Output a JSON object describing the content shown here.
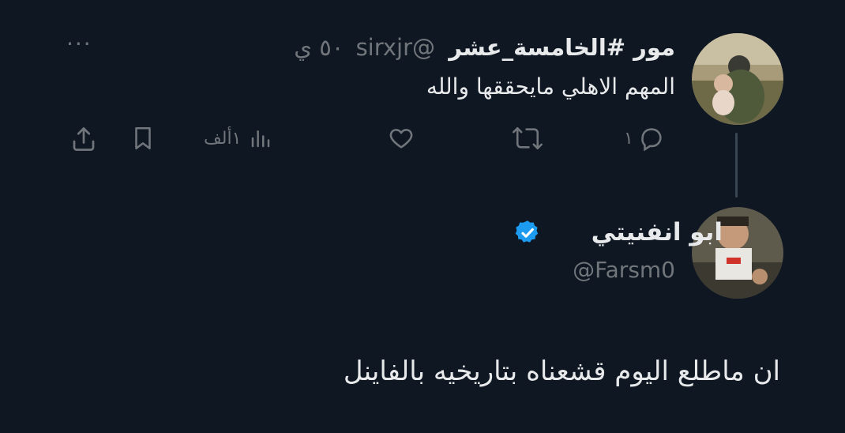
{
  "tweet": {
    "display_name": "مور #الخامسة_عشر",
    "handle": "@sirxjr",
    "time": "٥٠ ي",
    "text": "المهم الاهلي مايحققها والله",
    "more_label": "···",
    "actions": {
      "reply_count": "١",
      "retweet_count": "",
      "like_count": "",
      "views_count": "١ألف"
    }
  },
  "reply": {
    "display_name": "ابو انفنيتي",
    "handle": "@Farsm0",
    "verified": true,
    "text": "ان ماطلع اليوم قشعناه بتاريخيه بالفاينل"
  },
  "colors": {
    "background": "#0f1723",
    "text": "#e7e9ea",
    "muted": "#71767b",
    "verified": "#1d9bf0"
  },
  "icons": [
    "reply-icon",
    "retweet-icon",
    "like-icon",
    "views-icon",
    "bookmark-icon",
    "share-icon",
    "more-icon",
    "verified-badge-icon"
  ]
}
